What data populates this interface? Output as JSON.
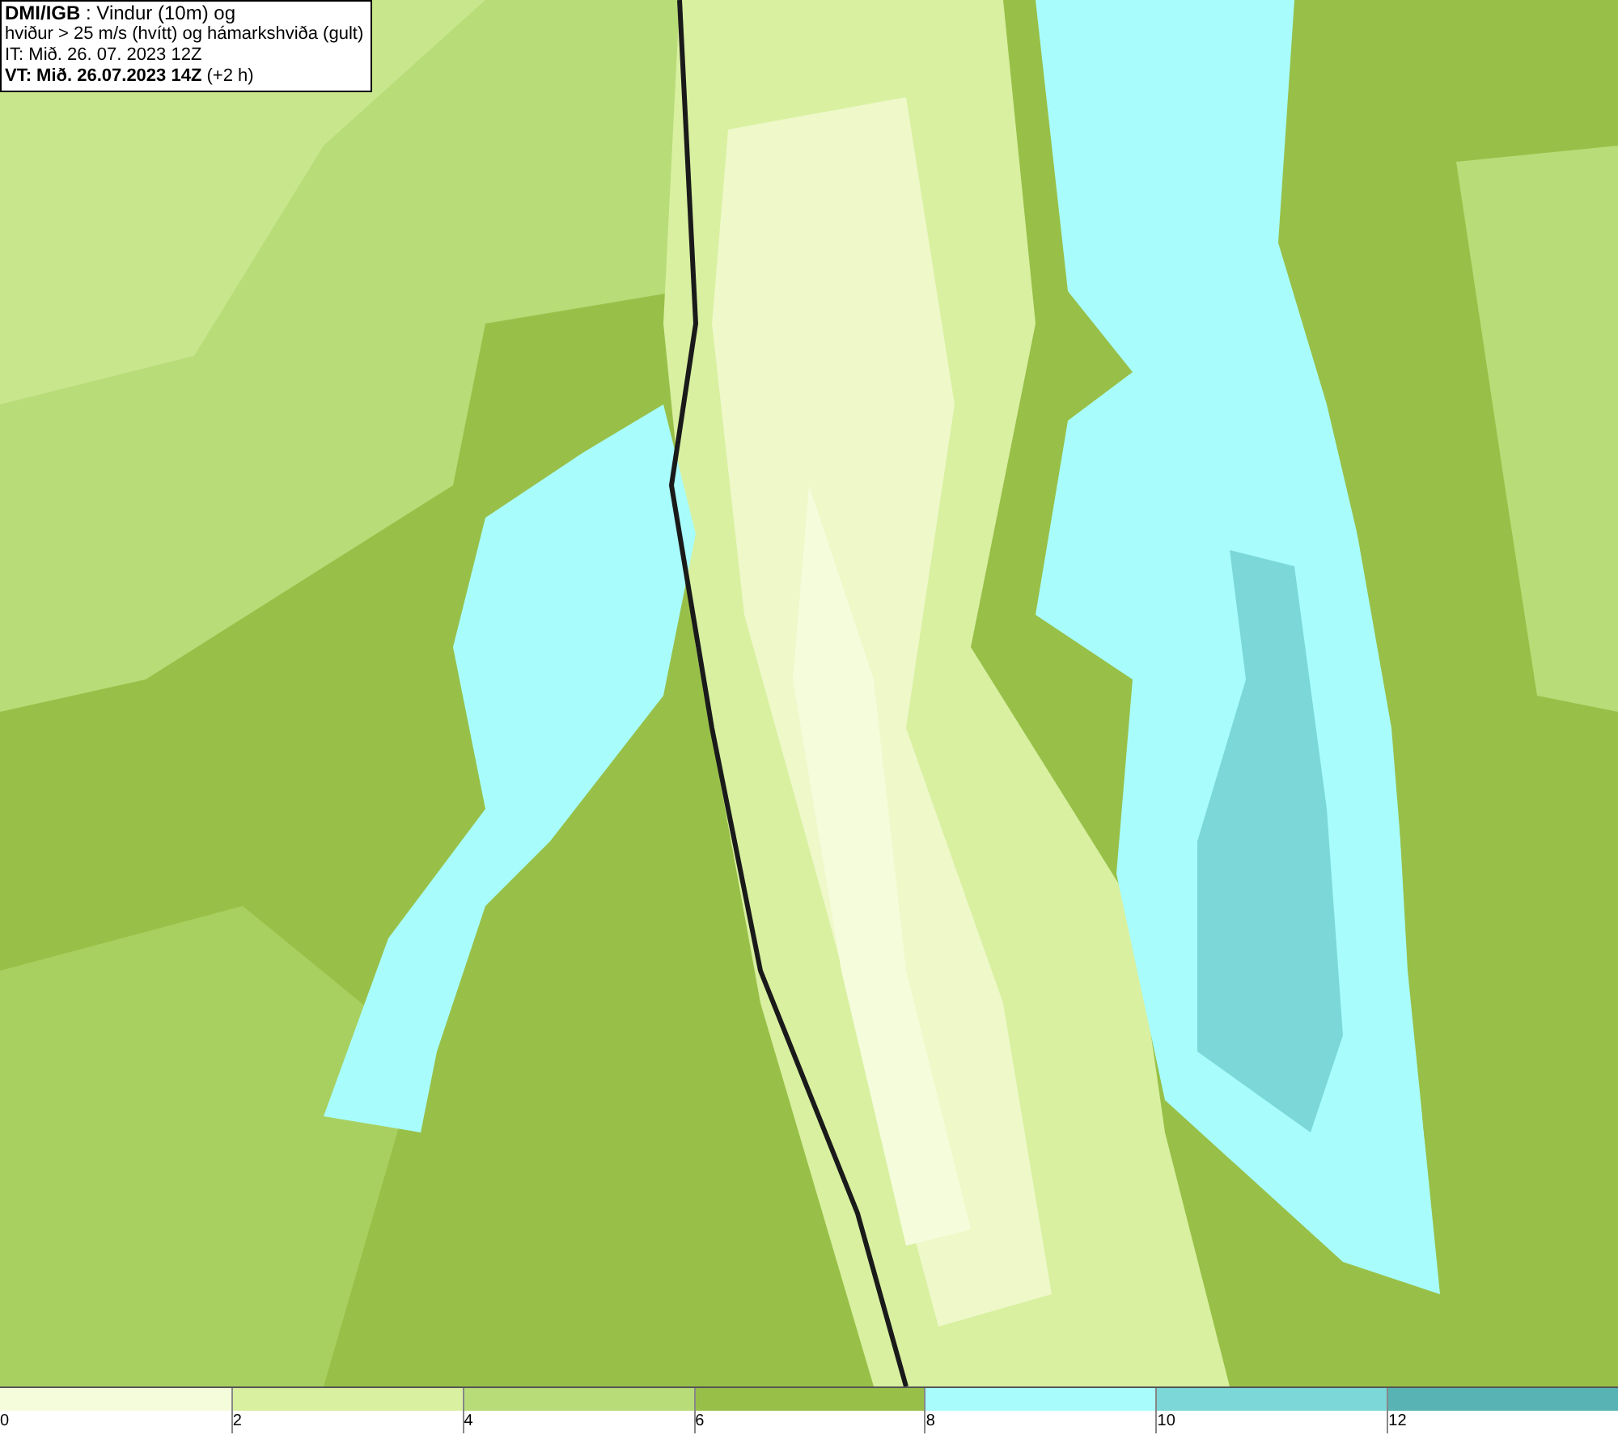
{
  "header": {
    "lines": [
      "**DMI/IGB** : Vindur (10m) og",
      "hviður > 25 m/s (hvítt) og hámarkshviða (gult)",
      "IT: Mið. 26. 07. 2023 12Z",
      "**VT: Mið. 26.07.2023 14Z** (+2 h)"
    ]
  },
  "legend": {
    "swatches": [
      {
        "color": "#f5fcdc",
        "label": "0"
      },
      {
        "color": "#d8f0a0",
        "label": "2"
      },
      {
        "color": "#b8dc78",
        "label": "4"
      },
      {
        "color": "#98c048",
        "label": "6"
      },
      {
        "color": "#a8fcfc",
        "label": "8"
      },
      {
        "color": "#7cd8d8",
        "label": "10"
      },
      {
        "color": "#58b4b4",
        "label": "12"
      }
    ]
  }
}
